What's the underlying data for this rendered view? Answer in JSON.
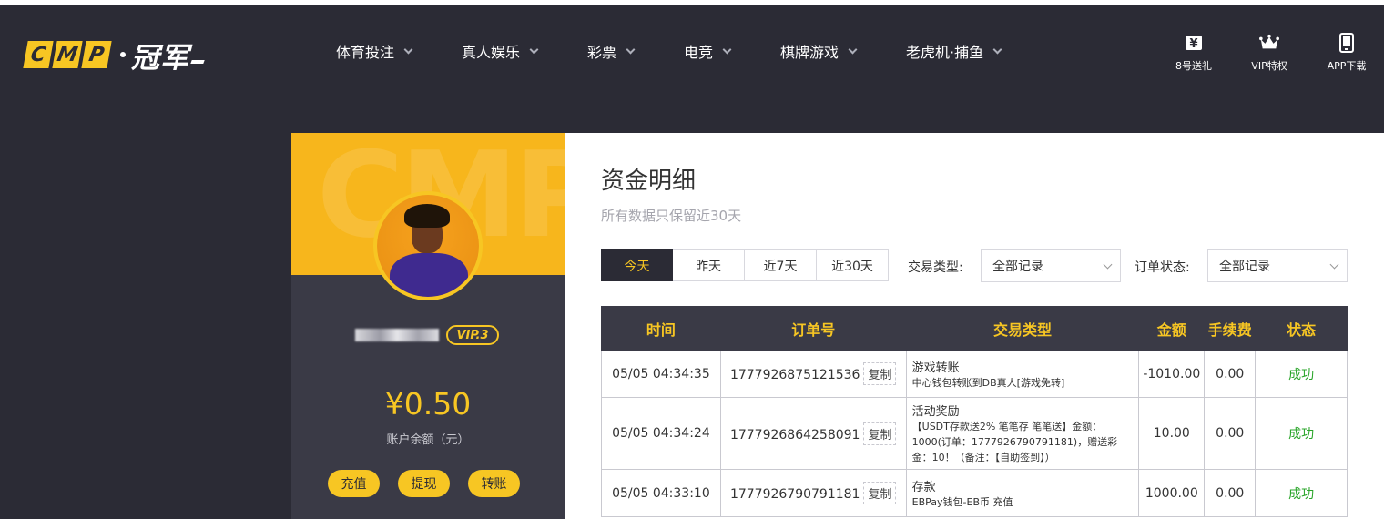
{
  "header": {
    "logo_letters": [
      "C",
      "M",
      "P"
    ],
    "logo_cn": "冠军",
    "nav": [
      {
        "label": "体育投注"
      },
      {
        "label": "真人娱乐"
      },
      {
        "label": "彩票"
      },
      {
        "label": "电竞"
      },
      {
        "label": "棋牌游戏"
      },
      {
        "label": "老虎机·捕鱼"
      }
    ],
    "icons": [
      {
        "label": "8号送礼",
        "icon": "gift-ticket-icon"
      },
      {
        "label": "VIP特权",
        "icon": "crown-icon"
      },
      {
        "label": "APP下载",
        "icon": "phone-icon"
      }
    ]
  },
  "profile": {
    "banner_watermark": "CMP",
    "vip_level": "VIP.3",
    "balance": "¥0.50",
    "balance_label": "账户余额（元）",
    "actions": [
      "充值",
      "提现",
      "转账"
    ]
  },
  "main": {
    "title": "资金明细",
    "subtitle": "所有数据只保留近30天",
    "tabs": [
      {
        "label": "今天",
        "active": true
      },
      {
        "label": "昨天",
        "active": false
      },
      {
        "label": "近7天",
        "active": false
      },
      {
        "label": "近30天",
        "active": false
      }
    ],
    "filters": {
      "type_label": "交易类型:",
      "type_value": "全部记录",
      "status_label": "订单状态:",
      "status_value": "全部记录"
    },
    "table": {
      "headers": [
        "时间",
        "订单号",
        "交易类型",
        "金额",
        "手续费",
        "状态"
      ],
      "copy_label": "复制",
      "rows": [
        {
          "time": "05/05 04:34:35",
          "order": "1777926875121536",
          "type_main": "游戏转账",
          "type_sub": "中心钱包转账到DB真人[游戏免转]",
          "amount": "-1010.00",
          "fee": "0.00",
          "status": "成功"
        },
        {
          "time": "05/05 04:34:24",
          "order": "1777926864258091",
          "type_main": "活动奖励",
          "type_sub": "【USDT存款送2% 笔笔存 笔笔送】金额：1000(订单：1777926790791181)，赠送彩金：10！（备注：【自助签到】）",
          "amount": "10.00",
          "fee": "0.00",
          "status": "成功"
        },
        {
          "time": "05/05 04:33:10",
          "order": "1777926790791181",
          "type_main": "存款",
          "type_sub": "EBPay钱包-EB币 充值",
          "amount": "1000.00",
          "fee": "0.00",
          "status": "成功"
        }
      ]
    }
  },
  "colors": {
    "dark": "#2b2b35",
    "panel": "#3a3a46",
    "accent": "#f7c623",
    "success": "#2aa52a"
  }
}
